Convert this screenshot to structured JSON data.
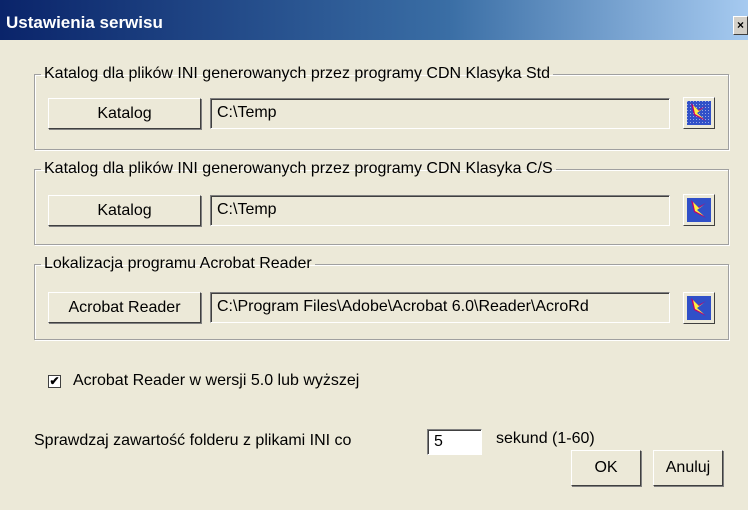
{
  "window": {
    "title": "Ustawienia serwisu",
    "close_label": "×"
  },
  "groups": [
    {
      "legend": "Katalog dla plików INI generowanych przez programy CDN Klasyka Std",
      "button_label": "Katalog",
      "path_value": "C:\\Temp",
      "icon": "folder-browse-icon"
    },
    {
      "legend": "Katalog dla plików INI generowanych przez programy CDN Klasyka C/S",
      "button_label": "Katalog",
      "path_value": "C:\\Temp",
      "icon": "folder-browse-icon"
    },
    {
      "legend": "Lokalizacja programu Acrobat Reader",
      "button_label": "Acrobat Reader",
      "path_value": "C:\\Program Files\\Adobe\\Acrobat 6.0\\Reader\\AcroRd",
      "icon": "folder-browse-icon"
    }
  ],
  "acrobat_checkbox": {
    "checked": true,
    "label": "Acrobat Reader w wersji 5.0 lub wyższej"
  },
  "interval": {
    "label_before": "Sprawdzaj zawartość folderu z plikami INI co",
    "value": "5",
    "label_after": "sekund (1-60)"
  },
  "buttons": {
    "ok": "OK",
    "cancel": "Anuluj"
  },
  "colors": {
    "face": "#ECE9D8",
    "title_start": "#0A246A",
    "title_end": "#A6CAF0"
  }
}
